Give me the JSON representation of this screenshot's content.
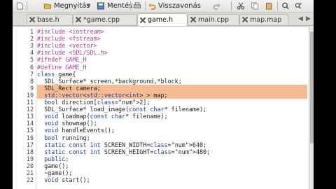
{
  "toolbar": {
    "open_label": "Megnyitás",
    "save_label": "Mentés",
    "undo_label": "Visszavonás"
  },
  "tabs": [
    {
      "label": "base.h",
      "active": false
    },
    {
      "label": "*game.cpp",
      "active": false
    },
    {
      "label": "game.h",
      "active": true
    },
    {
      "label": "main.cpp",
      "active": false
    },
    {
      "label": "map.map",
      "active": false
    }
  ],
  "editor": {
    "highlighted_lines": [
      9,
      10
    ],
    "lines": [
      {
        "n": "1",
        "text": "#include <iostream>"
      },
      {
        "n": "2",
        "text": "#include <fstream>"
      },
      {
        "n": "3",
        "text": "#include <vector>"
      },
      {
        "n": "4",
        "text": "#include <SDL/SDL.h>"
      },
      {
        "n": "5",
        "text": "#ifndef GAME_H"
      },
      {
        "n": "6",
        "text": "#define GAME_H"
      },
      {
        "n": "7",
        "text": "class game{"
      },
      {
        "n": "8",
        "text": "  SDL_Surface* screen,*background,*block;"
      },
      {
        "n": "9",
        "text": "  SDL_Rect camera;"
      },
      {
        "n": "10",
        "text": "  std::vector<std::vector<int> > map;"
      },
      {
        "n": "11",
        "text": "  bool direction[2];"
      },
      {
        "n": "12",
        "text": "  SDL_Surface* load_image(const char* filename);"
      },
      {
        "n": "13",
        "text": "  void loadmap(const char* filename);"
      },
      {
        "n": "14",
        "text": "  void showmap();"
      },
      {
        "n": "15",
        "text": "  void handleEvents();"
      },
      {
        "n": "16",
        "text": "  bool running;"
      },
      {
        "n": "17",
        "text": "  static const int SCREEN_WIDTH=640;"
      },
      {
        "n": "18",
        "text": "  static const int SCREEN_HEIGHT=480;"
      },
      {
        "n": "19",
        "text": "  public:"
      },
      {
        "n": "20",
        "text": "  game();"
      },
      {
        "n": "21",
        "text": "  ~game();"
      },
      {
        "n": "22",
        "text": "  void start();"
      }
    ]
  },
  "colors": {
    "highlight": "#f7bb92",
    "preprocessor": "#b0439f",
    "keyword": "#1a3ea8",
    "number": "#c45012"
  }
}
